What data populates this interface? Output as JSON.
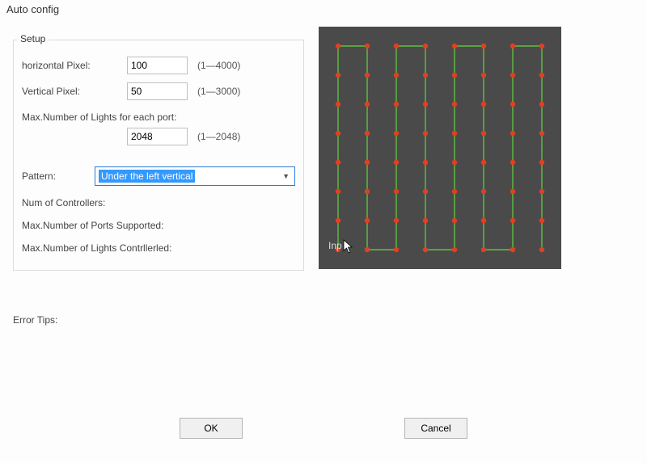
{
  "window_title": "Auto config",
  "setup": {
    "legend": "Setup",
    "horizontal_label": "horizontal Pixel:",
    "horizontal_value": "100",
    "horizontal_range": "(1—4000)",
    "vertical_label": "Vertical Pixel:",
    "vertical_value": "50",
    "vertical_range": "(1—3000)",
    "max_lights_label": "Max.Number of Lights for each port:",
    "max_lights_value": "2048",
    "max_lights_range": "(1—2048)",
    "pattern_label": "Pattern:",
    "pattern_selected": "Under the left vertical",
    "num_controllers": "Num of Controllers:",
    "max_ports": "Max.Number of Ports Supported:",
    "max_lights_controlled": "Max.Number of Lights Contrllerled:"
  },
  "error_tips_label": "Error Tips:",
  "preview_label": "Inp",
  "buttons": {
    "ok": "OK",
    "cancel": "Cancel"
  },
  "preview_grid": {
    "cols": 8,
    "rows": 8,
    "line_color": "#5fbf3f",
    "dot_color": "#e04020"
  }
}
